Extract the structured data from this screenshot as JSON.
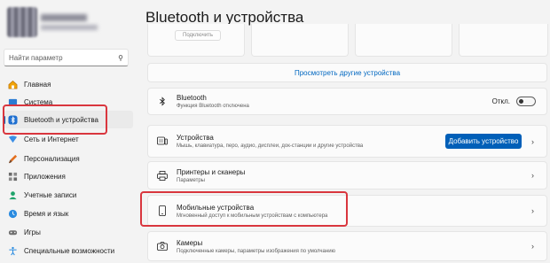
{
  "sidebar": {
    "search_placeholder": "Найти параметр",
    "search_icon": "search-icon",
    "items": [
      {
        "label": "Главная",
        "icon": "home-icon"
      },
      {
        "label": "Система",
        "icon": "monitor-icon"
      },
      {
        "label": "Bluetooth и устройства",
        "icon": "bluetooth-icon"
      },
      {
        "label": "Сеть и Интернет",
        "icon": "wifi-icon"
      },
      {
        "label": "Персонализация",
        "icon": "brush-icon"
      },
      {
        "label": "Приложения",
        "icon": "apps-icon"
      },
      {
        "label": "Учетные записи",
        "icon": "person-icon"
      },
      {
        "label": "Время и язык",
        "icon": "globe-clock-icon"
      },
      {
        "label": "Игры",
        "icon": "gamepad-icon"
      },
      {
        "label": "Специальные возможности",
        "icon": "accessibility-icon"
      }
    ]
  },
  "main": {
    "title": "Bluetooth и устройства",
    "tile_button": "Подключить",
    "more_devices_link": "Просмотреть другие устройства",
    "rows": {
      "bluetooth": {
        "title": "Bluetooth",
        "subtitle": "Функция Bluetooth отключена",
        "toggle_label": "Откл."
      },
      "devices": {
        "title": "Устройства",
        "subtitle": "Мышь, клавиатура, перо, аудио, дисплеи, док-станции и другие устройства",
        "button": "Добавить устройство"
      },
      "printers": {
        "title": "Принтеры и сканеры",
        "subtitle": "Параметры"
      },
      "mobile": {
        "title": "Мобильные устройства",
        "subtitle": "Мгновенный доступ к мобильным устройствам с компьютера"
      },
      "cameras": {
        "title": "Камеры",
        "subtitle": "Подключенные камеры, параметры изображения по умолчанию"
      }
    }
  },
  "colors": {
    "accent": "#005fb8",
    "highlight": "#d9363e",
    "link": "#0067c0"
  }
}
